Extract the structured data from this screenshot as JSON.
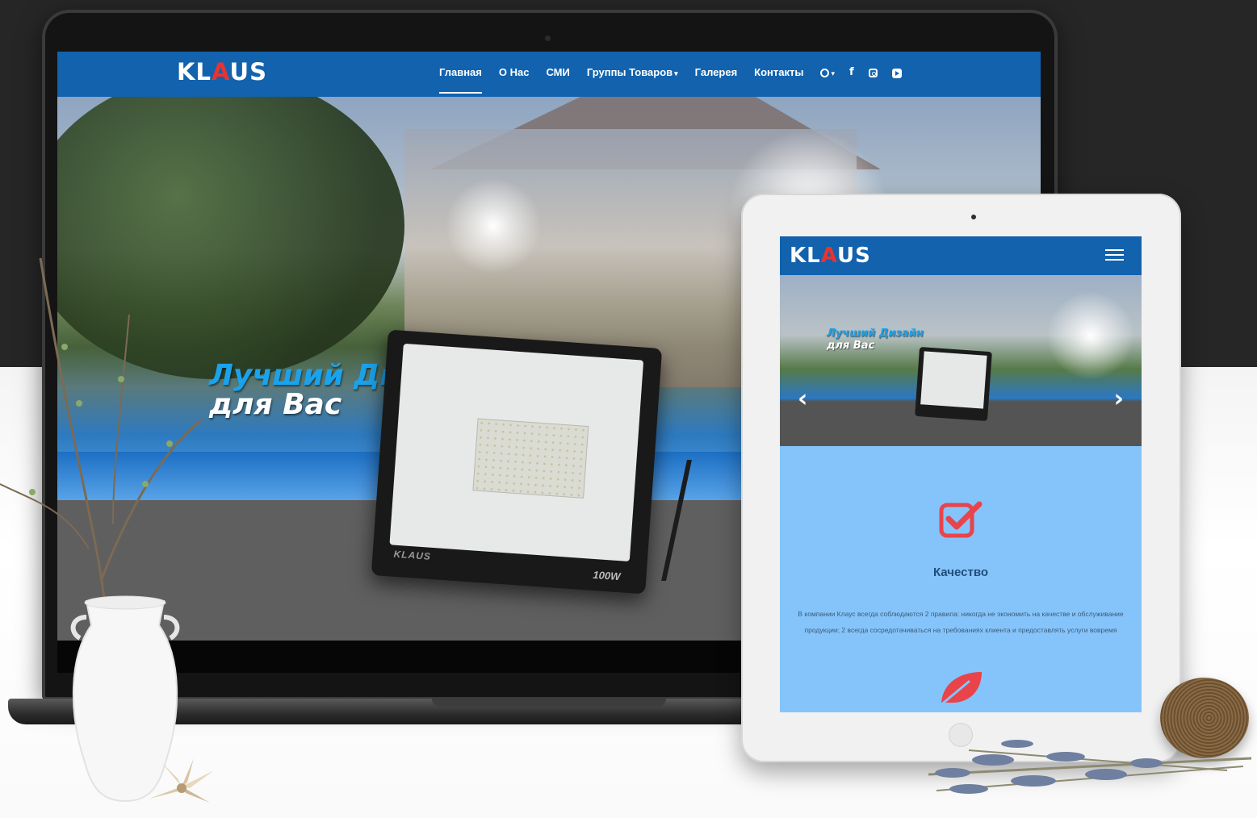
{
  "colors": {
    "nav_blue": "#1262ae",
    "accent_blue": "#1aa3ec",
    "logo_red": "#e8332e",
    "tablet_content_bg": "#85c4fb",
    "feature_icon_red": "#e8444a"
  },
  "brand": {
    "logo_prefix": "KL",
    "logo_a": "A",
    "logo_suffix": "US"
  },
  "laptop": {
    "nav": {
      "items": [
        {
          "label": "Главная",
          "active": true
        },
        {
          "label": "О Нас"
        },
        {
          "label": "СМИ"
        },
        {
          "label": "Группы Товаров",
          "has_dropdown": true
        },
        {
          "label": "Галерея"
        },
        {
          "label": "Контакты"
        }
      ],
      "icons": [
        "globe-icon",
        "facebook-icon",
        "instagram-icon",
        "youtube-icon"
      ]
    },
    "hero": {
      "title_line1": "Лучший Дизайн",
      "title_line2": "для Вас"
    },
    "product": {
      "brand": "KLAUS",
      "wattage": "100W"
    }
  },
  "tablet": {
    "hero": {
      "title_line1": "Лучший Дизайн",
      "title_line2": "для Вас",
      "active_slide": 4,
      "slide_count": 5
    },
    "feature": {
      "icon": "checkbox-icon",
      "title": "Качество",
      "text": "В компании Клаус всегда соблюдаются 2 правила: никогда не экономить на качестве и обслуживание продукции; 2 всегда сосредотачиваться на требованиях клиента и предоставлять услуги вовремя"
    },
    "next_feature_icon": "leaf-icon"
  }
}
